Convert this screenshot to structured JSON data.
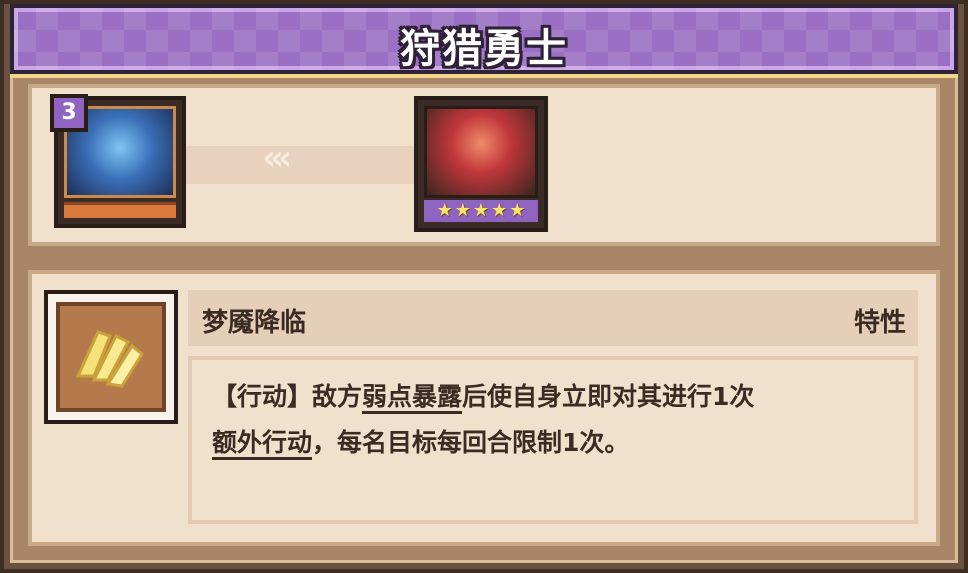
{
  "banner": {
    "title": "狩猎勇士"
  },
  "hero_left": {
    "level": "3"
  },
  "evolution": {
    "arrow": "‹‹‹"
  },
  "hero_right": {
    "stars": [
      "★",
      "★",
      "★",
      "★",
      "★"
    ],
    "star_count": 5
  },
  "skill": {
    "name": "梦魇降临",
    "type": "特性",
    "desc_part1": "【行动】敌方",
    "desc_keyword1": "弱点暴露",
    "desc_part2": "后使自身立即对其进行1次",
    "desc_keyword2": "额外行动",
    "desc_part3": "，每名目标每回合限制1次。"
  },
  "colors": {
    "banner": "#9b6fc4",
    "panel": "#f0e0cc",
    "frame": "#6b5240",
    "star": "#ffe46a"
  }
}
